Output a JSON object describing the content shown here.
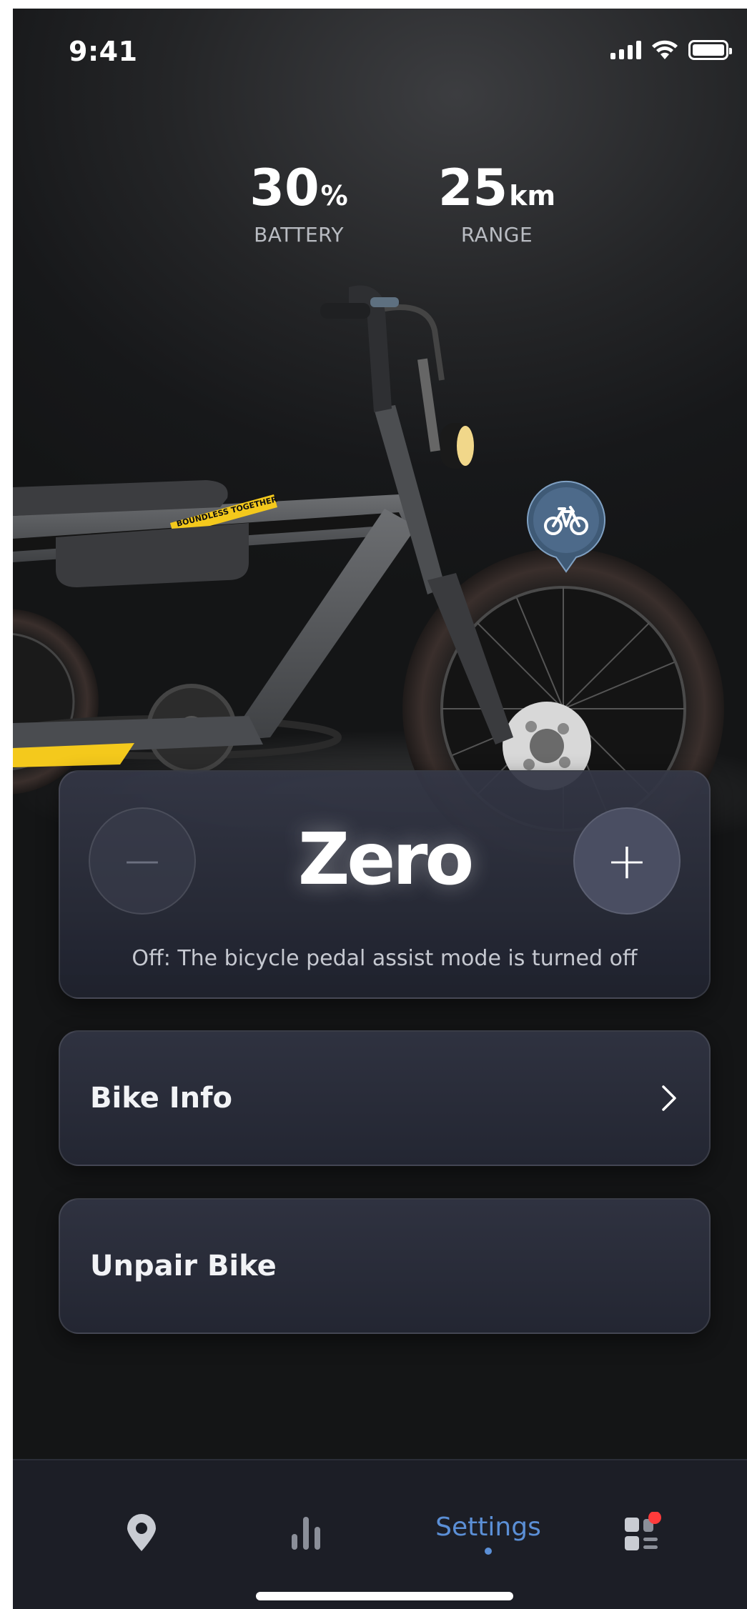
{
  "status_bar": {
    "time": "9:41",
    "icons": [
      "signal-icon",
      "wifi-icon",
      "battery-icon"
    ]
  },
  "stats": {
    "battery": {
      "value": "30",
      "unit": "%",
      "label": "BATTERY"
    },
    "range": {
      "value": "25",
      "unit": "km",
      "label": "RANGE"
    }
  },
  "bike": {
    "decal_text": "BOUNDLESS TOGETHER",
    "pin_icon": "bicycle-icon"
  },
  "assist": {
    "decrease_icon": "minus-icon",
    "increase_icon": "plus-icon",
    "decrease_glyph": "−",
    "increase_glyph": "+",
    "mode": "Zero",
    "description": "Off: The bicycle pedal assist mode is turned off"
  },
  "menu": {
    "bike_info": "Bike Info",
    "unpair": "Unpair Bike"
  },
  "tabbar": {
    "tabs": [
      {
        "icon": "location-pin-icon",
        "label": ""
      },
      {
        "icon": "bar-chart-icon",
        "label": ""
      },
      {
        "icon": "",
        "label": "Settings",
        "active": true
      },
      {
        "icon": "dashboard-icon",
        "label": "",
        "badge": true
      }
    ]
  },
  "colors": {
    "accent": "#5b8fd6",
    "badge": "#ff3b3b",
    "decal_yellow": "#f4c91c"
  }
}
